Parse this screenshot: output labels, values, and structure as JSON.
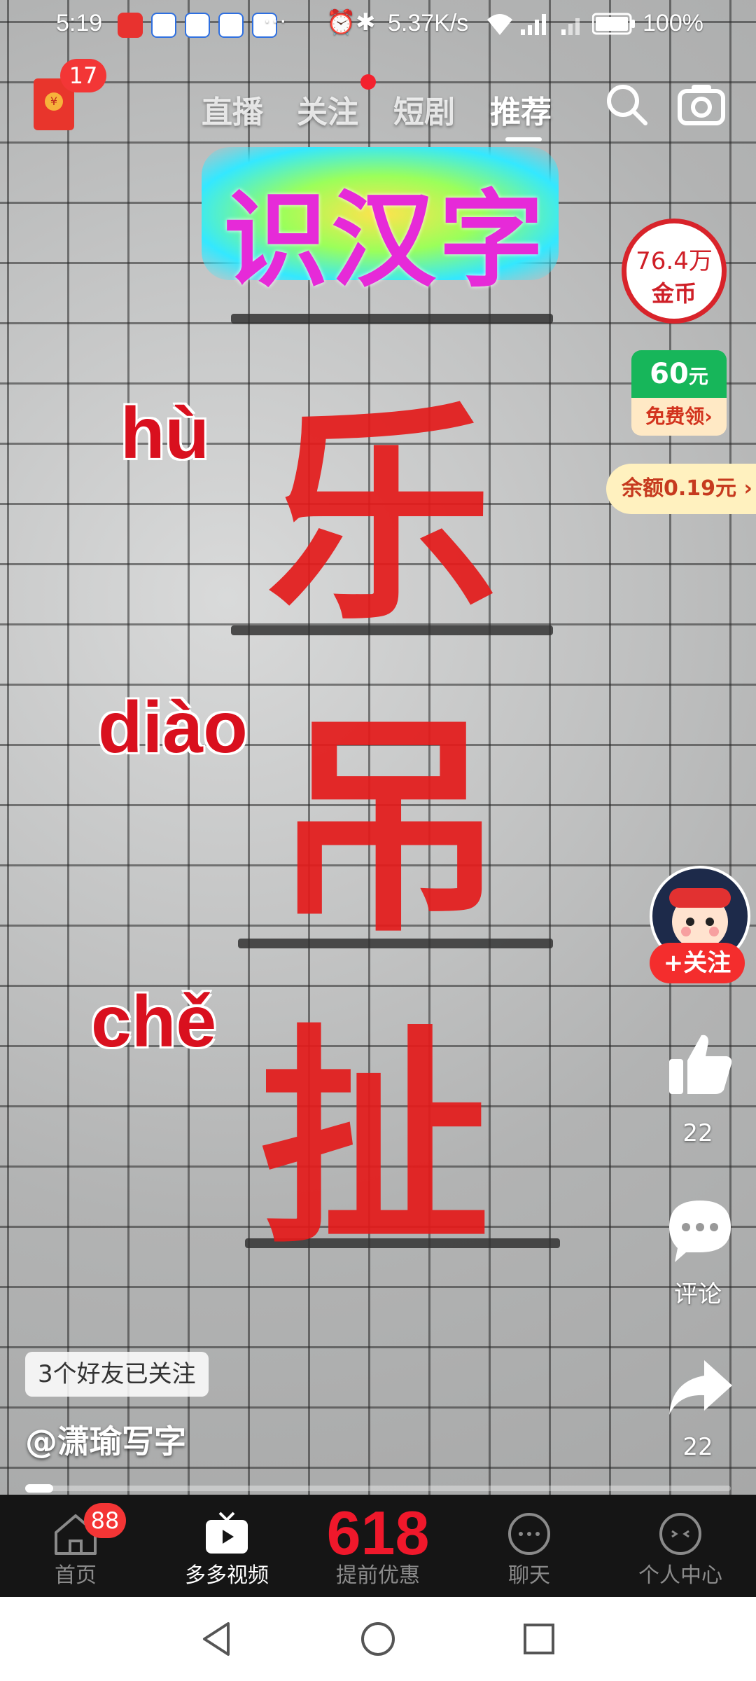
{
  "status_bar": {
    "time": "5:19",
    "dots": "···",
    "net_speed": "5.37K/s",
    "battery": "100%"
  },
  "red_packet": {
    "badge": "17"
  },
  "top_tabs": [
    {
      "label": "直播"
    },
    {
      "label": "关注"
    },
    {
      "label": "短剧"
    },
    {
      "label": "推荐"
    }
  ],
  "video": {
    "title": "识汉字",
    "pinyin": [
      "hù",
      "diào",
      "chě"
    ],
    "chars": [
      "乐",
      "吊",
      "扯"
    ]
  },
  "right_panel": {
    "coins_amount": "76.4万",
    "coins_unit": "金币",
    "promo_amount": "60",
    "promo_unit": "元",
    "promo_action": "免费领",
    "balance": "余额0.19元"
  },
  "actions": {
    "follow": "+关注",
    "like_count": "22",
    "comment_label": "评论",
    "share_count": "22"
  },
  "info": {
    "friends_followed": "3个好友已关注",
    "author": "@潇瑜写字"
  },
  "progress": {
    "fraction": 0.04
  },
  "bottom_nav": {
    "items": [
      {
        "label": "首页",
        "badge": "88"
      },
      {
        "label": "多多视频"
      },
      {
        "label": "提前优惠",
        "promo": "618"
      },
      {
        "label": "聊天"
      },
      {
        "label": "个人中心"
      }
    ]
  },
  "colors": {
    "accent_red": "#e41b1b",
    "promo_green": "#17b65a",
    "nav_bg": "#151515"
  }
}
